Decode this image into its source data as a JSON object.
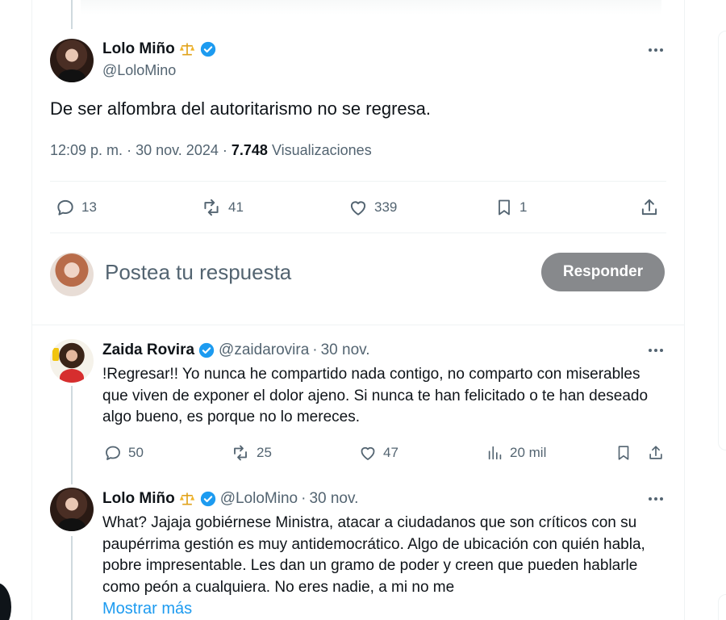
{
  "tweet": {
    "author_name": "Lolo Miño",
    "author_emoji": "⚖️",
    "author_handle": "@LoloMino",
    "text": "De ser alfombra del autoritarismo no se regresa.",
    "time": "12:09 p. m.",
    "date": "30 nov. 2024",
    "views_count": "7.748",
    "views_label": "Visualizaciones",
    "separator": "·",
    "stats": {
      "replies": "13",
      "reposts": "41",
      "likes": "339",
      "bookmarks": "1"
    }
  },
  "composer": {
    "placeholder": "Postea tu respuesta",
    "button_label": "Responder"
  },
  "replies": [
    {
      "author_name": "Zaida Rovira",
      "author_handle": "@zaidarovira",
      "date": "30 nov.",
      "text": "!Regresar!! Yo nunca he compartido nada contigo, no comparto con miserables que  viven de exponer el dolor ajeno. Si nunca te han felicitado o te han deseado algo bueno, es porque no lo mereces.",
      "stats": {
        "replies": "50",
        "reposts": "25",
        "likes": "47",
        "views": "20 mil"
      }
    },
    {
      "author_name": "Lolo Miño",
      "author_emoji": "⚖️",
      "author_handle": "@LoloMino",
      "date": "30 nov.",
      "text": "What? Jajaja gobiérnese Ministra, atacar a ciudadanos que son críticos con su paupérrima gestión es muy antidemocrático. Algo de ubicación con quién habla, pobre impresentable. Les dan un gramo de poder y creen que pueden hablarle como peón a cualquiera. No eres nadie, a mi no me",
      "show_more": "Mostrar más"
    }
  ],
  "colors": {
    "accent": "#1d9bf0",
    "verified": "#1d9bf0",
    "button_bg": "#87898c",
    "muted": "#536471"
  }
}
